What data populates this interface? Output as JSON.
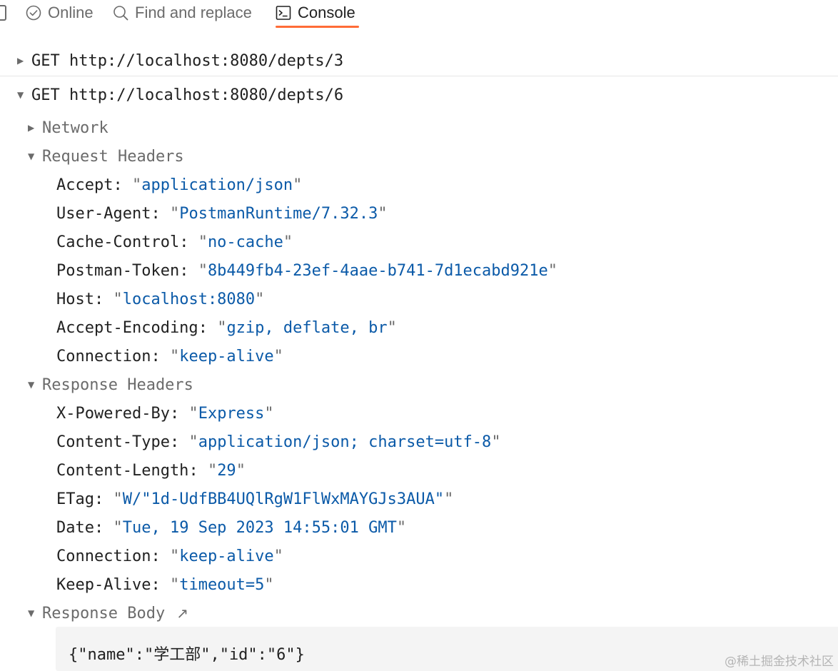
{
  "tabs": {
    "online": "Online",
    "find": "Find and replace",
    "console": "Console"
  },
  "logs": [
    {
      "method": "GET",
      "url": "http://localhost:8080/depts/3",
      "expanded": false
    },
    {
      "method": "GET",
      "url": "http://localhost:8080/depts/6",
      "expanded": true
    }
  ],
  "sections": {
    "network": "Network",
    "request_headers": "Request Headers",
    "response_headers": "Response Headers",
    "response_body": "Response Body"
  },
  "request_headers": [
    {
      "key": "Accept",
      "value": "application/json"
    },
    {
      "key": "User-Agent",
      "value": "PostmanRuntime/7.32.3"
    },
    {
      "key": "Cache-Control",
      "value": "no-cache"
    },
    {
      "key": "Postman-Token",
      "value": "8b449fb4-23ef-4aae-b741-7d1ecabd921e"
    },
    {
      "key": "Host",
      "value": "localhost:8080"
    },
    {
      "key": "Accept-Encoding",
      "value": "gzip, deflate, br"
    },
    {
      "key": "Connection",
      "value": "keep-alive"
    }
  ],
  "response_headers": [
    {
      "key": "X-Powered-By",
      "value": "Express"
    },
    {
      "key": "Content-Type",
      "value": "application/json; charset=utf-8"
    },
    {
      "key": "Content-Length",
      "value": "29"
    },
    {
      "key": "ETag",
      "value": "W/\"1d-UdfBB4UQlRgW1FlWxMAYGJs3AUA\""
    },
    {
      "key": "Date",
      "value": "Tue, 19 Sep 2023 14:55:01 GMT"
    },
    {
      "key": "Connection",
      "value": "keep-alive"
    },
    {
      "key": "Keep-Alive",
      "value": "timeout=5"
    }
  ],
  "response_body": "{\"name\":\"学工部\",\"id\":\"6\"}",
  "watermark": "@稀土掘金技术社区",
  "colors": {
    "accent": "#ff6c37",
    "value": "#0b5aa8",
    "muted": "#6b6b6b",
    "text": "#212121"
  }
}
